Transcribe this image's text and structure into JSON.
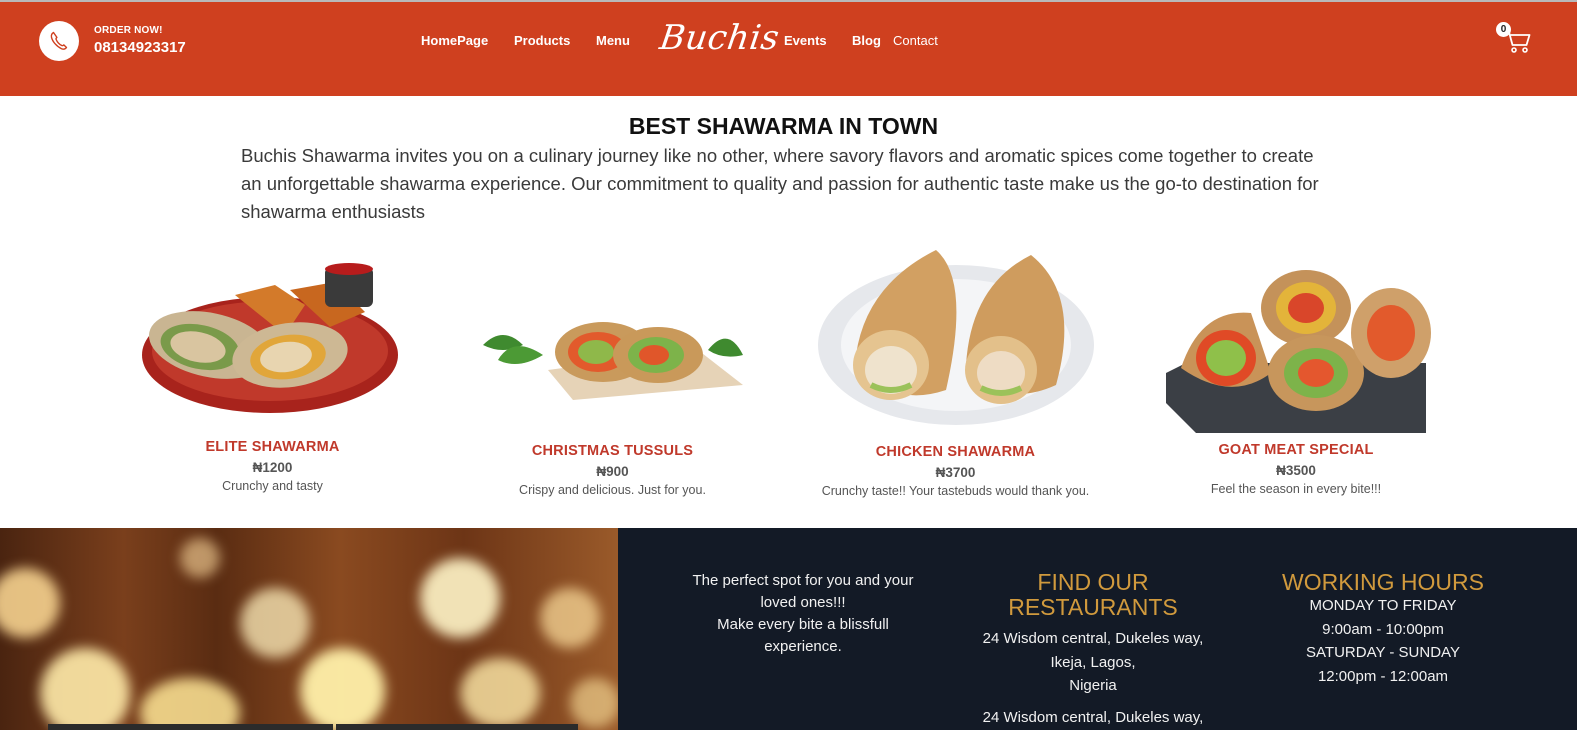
{
  "header": {
    "order_label": "ORDER NOW!",
    "phone": "08134923317",
    "brand": "Buchis",
    "nav": [
      "HomePage",
      "Products",
      "Menu",
      "Events",
      "Blog",
      "Contact"
    ],
    "cart_count": "0",
    "bg_color": "#cf401f"
  },
  "intro": {
    "title": "BEST SHAWARMA IN TOWN",
    "text": "Buchis Shawarma invites you on a culinary journey like no other, where savory flavors and aromatic spices come together to create an unforgettable shawarma experience. Our commitment to quality and passion for authentic taste make us the go-to destination for shawarma enthusiasts"
  },
  "products": [
    {
      "name": "ELITE SHAWARMA",
      "price": "₦1200",
      "desc": "Crunchy and tasty"
    },
    {
      "name": "CHRISTMAS TUSSULS",
      "price": "₦900",
      "desc": "Crispy and delicious. Just for you."
    },
    {
      "name": "CHICKEN SHAWARMA",
      "price": "₦3700",
      "desc": "Crunchy taste!! Your tastebuds would thank you."
    },
    {
      "name": "GOAT MEAT SPECIAL",
      "price": "₦3500",
      "desc": "Feel the season in every bite!!!"
    }
  ],
  "footer": {
    "tagline_line1": "The perfect spot for you and your loved ones!!!",
    "tagline_line2": "Make every bite a blissfull experience.",
    "find_title": "FIND OUR RESTAURANTS",
    "address1_line1": "24 Wisdom central, Dukeles way,",
    "address1_line2": "Ikeja, Lagos,",
    "address1_line3": "Nigeria",
    "address2_line1": "24 Wisdom central, Dukeles way,",
    "hours_title": "WORKING HOURS",
    "hours_1": "MONDAY TO FRIDAY",
    "hours_2": "9:00am - 10:00pm",
    "hours_3": "SATURDAY - SUNDAY",
    "hours_4": "12:00pm - 12:00am",
    "accent_color": "#d19a3d",
    "dark_bg": "#131a26"
  }
}
